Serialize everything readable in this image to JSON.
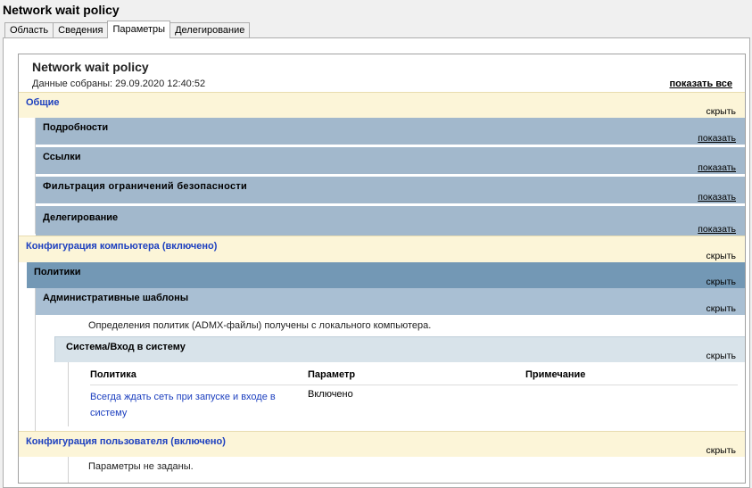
{
  "window": {
    "title": "Network wait policy"
  },
  "tabs": [
    {
      "label": "Область"
    },
    {
      "label": "Сведения"
    },
    {
      "label": "Параметры"
    },
    {
      "label": "Делегирование"
    }
  ],
  "report": {
    "title": "Network wait policy",
    "collected": "Данные собраны: 29.09.2020 12:40:52",
    "show_all": "показать все",
    "general": {
      "label": "Общие",
      "toggle": "скрыть"
    },
    "details": {
      "label": "Подробности",
      "toggle": "показать"
    },
    "links": {
      "label": "Ссылки",
      "toggle": "показать"
    },
    "security_filtering": {
      "label": "Фильтрация ограничений безопасности",
      "toggle": "показать"
    },
    "delegation": {
      "label": "Делегирование",
      "toggle": "показать"
    },
    "computer_config": {
      "label": "Конфигурация компьютера (включено)",
      "toggle": "скрыть"
    },
    "policies": {
      "label": "Политики",
      "toggle": "скрыть"
    },
    "admin_templates": {
      "label": "Административные шаблоны",
      "toggle": "скрыть"
    },
    "admx_note": "Определения политик (ADMX-файлы) получены с локального компьютера.",
    "system_logon": {
      "label": "Система/Вход в систему",
      "toggle": "скрыть"
    },
    "table": {
      "headers": [
        "Политика",
        "Параметр",
        "Примечание"
      ],
      "rows": [
        {
          "policy_line1": "Всегда ждать сеть при запуске и входе в",
          "policy_line2": "систему",
          "setting": "Включено",
          "comment": ""
        }
      ]
    },
    "user_config": {
      "label": "Конфигурация пользователя (включено)",
      "toggle": "скрыть"
    },
    "no_settings": "Параметры не заданы."
  }
}
